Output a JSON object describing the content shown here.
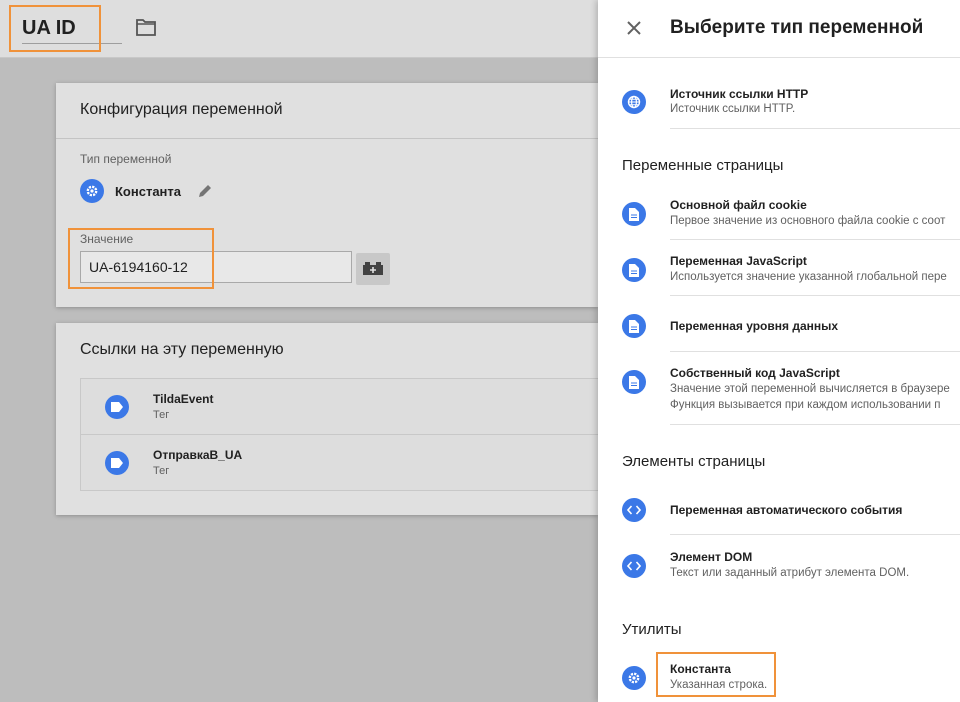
{
  "editor": {
    "title": "UA ID",
    "config_card": {
      "title": "Конфигурация переменной",
      "type_label": "Тип переменной",
      "type_name": "Константа",
      "value_label": "Значение",
      "value": "UA-6194160-12"
    },
    "refs_card": {
      "title": "Ссылки на эту переменную",
      "items": [
        {
          "name": "TildaEvent",
          "type": "Тег"
        },
        {
          "name": "ОтправкаВ_UA",
          "type": "Тег"
        }
      ]
    }
  },
  "panel": {
    "title": "Выберите тип переменной",
    "top_item": {
      "name": "Источник ссылки HTTP",
      "desc": "Источник ссылки HTTP."
    },
    "sections": [
      {
        "title": "Переменные страницы",
        "items": [
          {
            "name": "Основной файл cookie",
            "desc": "Первое значение из основного файла cookie с соот"
          },
          {
            "name": "Переменная JavaScript",
            "desc": "Используется значение указанной глобальной пере"
          },
          {
            "name": "Переменная уровня данных",
            "desc": ""
          },
          {
            "name": "Собственный код JavaScript",
            "desc": "Значение этой переменной вычисляется в браузере",
            "desc2": "Функция вызывается при каждом использовании п"
          }
        ]
      },
      {
        "title": "Элементы страницы",
        "items": [
          {
            "name": "Переменная автоматического события",
            "desc": ""
          },
          {
            "name": "Элемент DOM",
            "desc": "Текст или заданный атрибут элемента DOM."
          }
        ]
      },
      {
        "title": "Утилиты",
        "items": [
          {
            "name": "Константа",
            "desc": "Указанная строка."
          }
        ]
      }
    ]
  },
  "colors": {
    "accent": "#3b78e7",
    "highlight": "#f0923a"
  },
  "icons": [
    "folder-icon",
    "gear-icon",
    "pencil-icon",
    "variable-picker-icon",
    "tag-icon",
    "close-icon",
    "globe-icon",
    "document-icon",
    "code-icon"
  ]
}
